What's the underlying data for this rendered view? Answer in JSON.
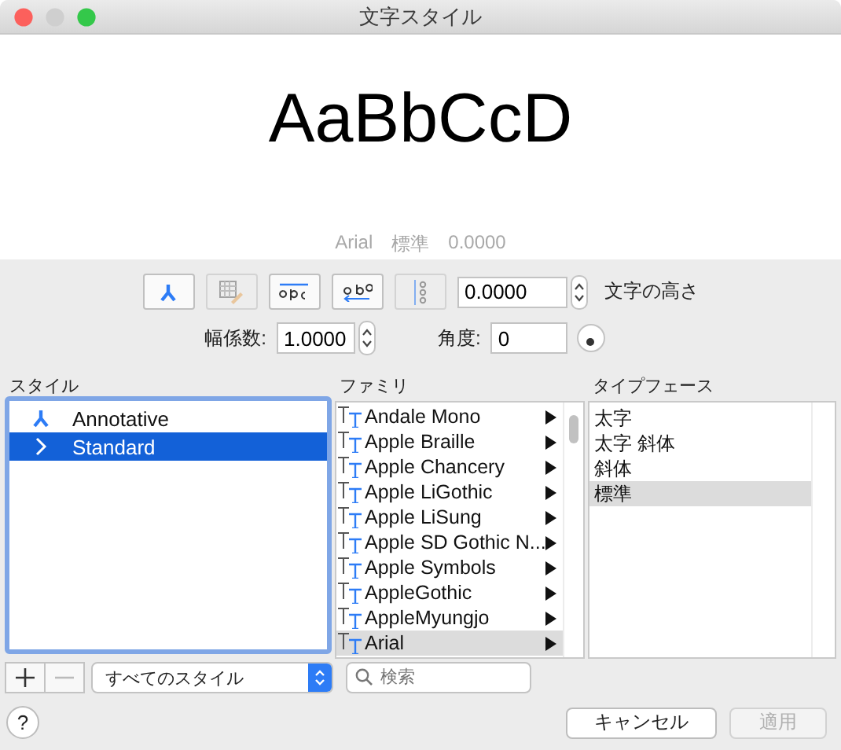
{
  "window": {
    "title": "文字スタイル"
  },
  "preview": {
    "sample": "AaBbCcD",
    "info": [
      "Arial",
      "標準",
      "0.0000"
    ]
  },
  "toolbar": {
    "buttons": [
      {
        "kind": "annotative",
        "disabled": false
      },
      {
        "kind": "match",
        "disabled": true
      },
      {
        "kind": "upside-down",
        "disabled": false
      },
      {
        "kind": "backwards",
        "disabled": false
      },
      {
        "kind": "vertical",
        "disabled": true
      }
    ],
    "height_value": "0.0000",
    "height_label": "文字の高さ"
  },
  "width_factor": {
    "label": "幅係数:",
    "value": "1.0000"
  },
  "angle": {
    "label": "角度:",
    "value": "0"
  },
  "styles": {
    "header": "スタイル",
    "items": [
      {
        "name": "Annotative",
        "kind": "annotative",
        "selected": false
      },
      {
        "name": "Standard",
        "kind": "current",
        "selected": true
      }
    ]
  },
  "family": {
    "header": "ファミリ",
    "items": [
      {
        "name": "Andale Mono",
        "selected": false
      },
      {
        "name": "Apple Braille",
        "selected": false
      },
      {
        "name": "Apple Chancery",
        "selected": false
      },
      {
        "name": "Apple LiGothic",
        "selected": false
      },
      {
        "name": "Apple LiSung",
        "selected": false
      },
      {
        "name": "Apple SD Gothic N...",
        "selected": false
      },
      {
        "name": "Apple Symbols",
        "selected": false
      },
      {
        "name": "AppleGothic",
        "selected": false
      },
      {
        "name": "AppleMyungjo",
        "selected": false
      },
      {
        "name": "Arial",
        "selected": true
      }
    ]
  },
  "typeface": {
    "header": "タイプフェース",
    "items": [
      {
        "name": "太字",
        "selected": false
      },
      {
        "name": "太字 斜体",
        "selected": false
      },
      {
        "name": "斜体",
        "selected": false
      },
      {
        "name": "標準",
        "selected": true
      }
    ]
  },
  "add_button": {
    "disabled": false
  },
  "remove_button": {
    "disabled": true
  },
  "filter": {
    "value": "すべてのスタイル"
  },
  "search": {
    "placeholder": "検索"
  },
  "help": "?",
  "buttons": [
    {
      "label": "キャンセル",
      "disabled": false
    },
    {
      "label": "適用",
      "disabled": true
    }
  ]
}
